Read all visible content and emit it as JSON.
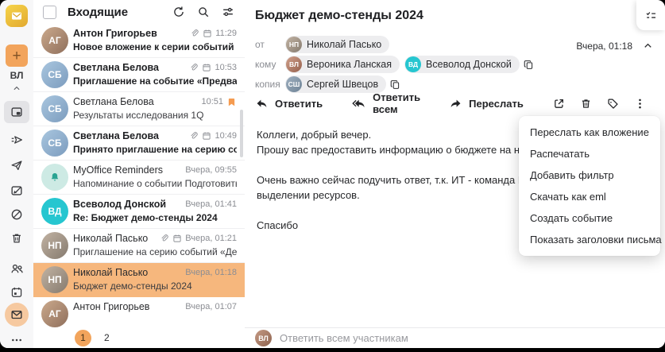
{
  "rail": {
    "plus_label": "+",
    "user_initials": "ВЛ"
  },
  "list": {
    "title": "Входящие",
    "rows": [
      {
        "name": "Антон Григорьев",
        "subject": "Новое вложение к серии событий «Аналити...",
        "time": "11:29",
        "unread": true,
        "attachment": true,
        "calendar": true,
        "flagged": false,
        "selected": false,
        "avatar": {
          "type": "initials",
          "text": "АГ",
          "theme": "ag"
        }
      },
      {
        "name": "Светлана Белова",
        "subject": "Приглашение на событие «Предварительно...",
        "time": "10:53",
        "unread": true,
        "attachment": true,
        "calendar": true,
        "flagged": false,
        "selected": false,
        "avatar": {
          "type": "initials",
          "text": "СБ",
          "theme": "sb"
        }
      },
      {
        "name": "Светлана Белова",
        "subject": "Результаты исследования 1Q",
        "time": "10:51",
        "unread": false,
        "attachment": false,
        "calendar": false,
        "flagged": true,
        "selected": false,
        "avatar": {
          "type": "initials",
          "text": "СБ",
          "theme": "sb"
        }
      },
      {
        "name": "Светлана Белова",
        "subject": "Принято приглашение на серию событий «...",
        "time": "10:49",
        "unread": true,
        "attachment": true,
        "calendar": true,
        "flagged": false,
        "selected": false,
        "avatar": {
          "type": "initials",
          "text": "СБ",
          "theme": "sb"
        }
      },
      {
        "name": "MyOffice Reminders",
        "subject": "Напоминание о событии Подготовить отчет...",
        "time": "Вчера, 09:55",
        "unread": false,
        "attachment": false,
        "calendar": false,
        "flagged": false,
        "selected": false,
        "avatar": {
          "type": "bell",
          "text": "",
          "theme": "bell"
        }
      },
      {
        "name": "Всеволод Донской",
        "subject": "Re: Бюджет демо-стенды 2024",
        "time": "Вчера, 01:41",
        "unread": true,
        "attachment": false,
        "calendar": false,
        "flagged": false,
        "selected": false,
        "avatar": {
          "type": "initials",
          "text": "ВД",
          "theme": "vd"
        }
      },
      {
        "name": "Николай Пасько",
        "subject": "Приглашение на серию событий «Демо стен...",
        "time": "Вчера, 01:21",
        "unread": false,
        "attachment": true,
        "calendar": true,
        "flagged": false,
        "selected": false,
        "avatar": {
          "type": "initials",
          "text": "НП",
          "theme": "np"
        }
      },
      {
        "name": "Николай Пасько",
        "subject": "Бюджет демо-стенды 2024",
        "time": "Вчера, 01:18",
        "unread": false,
        "attachment": false,
        "calendar": false,
        "flagged": false,
        "selected": true,
        "avatar": {
          "type": "initials",
          "text": "НП",
          "theme": "np"
        }
      },
      {
        "name": "Антон Григорьев",
        "subject": "",
        "time": "Вчера, 01:07",
        "unread": false,
        "attachment": false,
        "calendar": false,
        "flagged": false,
        "selected": false,
        "avatar": {
          "type": "initials",
          "text": "АГ",
          "theme": "ag"
        }
      }
    ],
    "pagination": {
      "pages": [
        "1",
        "2"
      ],
      "current": "1"
    }
  },
  "mail": {
    "subject": "Бюджет демо-стенды 2024",
    "date": "Вчера, 01:18",
    "from_label": "от",
    "from": [
      {
        "name": "Николай Пасько",
        "initials": "НП",
        "theme": "np"
      }
    ],
    "to_label": "кому",
    "to": [
      {
        "name": "Вероника Ланская",
        "initials": "ВЛ",
        "theme": "vl2"
      },
      {
        "name": "Всеволод Донской",
        "initials": "ВД",
        "theme": "vd"
      }
    ],
    "cc_label": "копия",
    "cc": [
      {
        "name": "Сергей Швецов",
        "initials": "СШ",
        "theme": "ss"
      }
    ],
    "actions": {
      "reply": "Ответить",
      "reply_all": "Ответить всем",
      "forward": "Переслать"
    },
    "body": [
      [
        "Коллеги, добрый вечер.",
        "Прошу вас предоставить информацию о бюджете на наши демонстраци"
      ],
      [
        "Очень важно сейчас подучить ответ, т.к. ИТ - команда Всеволода, уже",
        "выделении ресурсов."
      ],
      [
        "Спасибо"
      ]
    ],
    "menu": [
      "Переслать как вложение",
      "Распечатать",
      "Добавить фильтр",
      "Скачать как eml",
      "Создать событие",
      "Показать заголовки письма"
    ],
    "reply_bar": {
      "placeholder": "Ответить всем участникам",
      "initials": "ВЛ",
      "theme": "vl"
    }
  },
  "colors": {
    "accent": "#F2A45C",
    "selected_row": "#F6B77D",
    "teal_avatar": "#26C6D0",
    "flag": "#F59B50"
  }
}
